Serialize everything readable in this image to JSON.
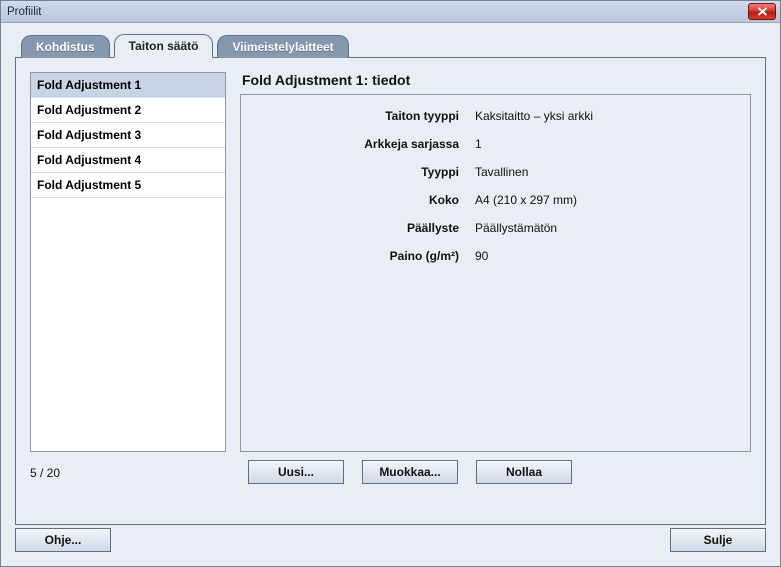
{
  "window": {
    "title": "Profiilit"
  },
  "tabs": [
    {
      "label": "Kohdistus"
    },
    {
      "label": "Taiton säätö"
    },
    {
      "label": "Viimeistelylaitteet"
    }
  ],
  "active_tab_index": 1,
  "profiles": [
    "Fold Adjustment 1",
    "Fold Adjustment 2",
    "Fold Adjustment 3",
    "Fold Adjustment 4",
    "Fold Adjustment 5"
  ],
  "selected_profile_index": 0,
  "counter": "5 / 20",
  "detail": {
    "title": "Fold Adjustment 1: tiedot",
    "rows": [
      {
        "label": "Taiton tyyppi",
        "value": "Kaksitaitto – yksi arkki"
      },
      {
        "label": "Arkkeja sarjassa",
        "value": "1"
      },
      {
        "label": "Tyyppi",
        "value": "Tavallinen"
      },
      {
        "label": "Koko",
        "value": "A4 (210 x 297 mm)"
      },
      {
        "label": "Päällyste",
        "value": "Päällystämätön"
      },
      {
        "label": "Paino (g/m²)",
        "value": "90"
      }
    ]
  },
  "buttons": {
    "new": "Uusi...",
    "edit": "Muokkaa...",
    "reset": "Nollaa",
    "help": "Ohje...",
    "close": "Sulje"
  }
}
